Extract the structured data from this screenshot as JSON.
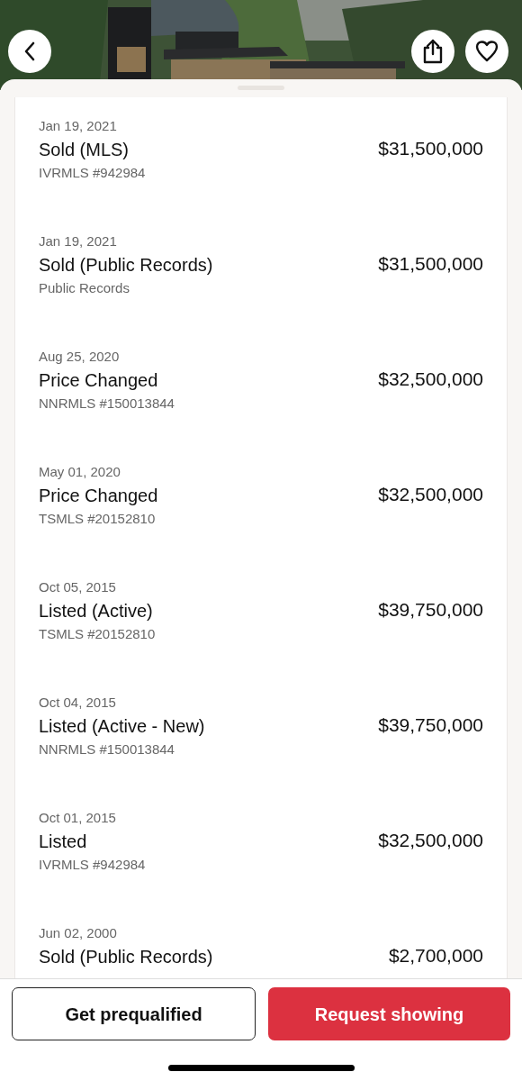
{
  "history": [
    {
      "date": "Jan 19, 2021",
      "event": "Sold (MLS)",
      "source": "IVRMLS #942984",
      "price": "$31,500,000"
    },
    {
      "date": "Jan 19, 2021",
      "event": "Sold (Public Records)",
      "source": "Public Records",
      "price": "$31,500,000"
    },
    {
      "date": "Aug 25, 2020",
      "event": "Price Changed",
      "source": "NNRMLS #150013844",
      "price": "$32,500,000"
    },
    {
      "date": "May 01, 2020",
      "event": "Price Changed",
      "source": "TSMLS #20152810",
      "price": "$32,500,000"
    },
    {
      "date": "Oct 05, 2015",
      "event": "Listed (Active)",
      "source": "TSMLS #20152810",
      "price": "$39,750,000"
    },
    {
      "date": "Oct 04, 2015",
      "event": "Listed (Active - New)",
      "source": "NNRMLS #150013844",
      "price": "$39,750,000"
    },
    {
      "date": "Oct 01, 2015",
      "event": "Listed",
      "source": "IVRMLS #942984",
      "price": "$32,500,000"
    },
    {
      "date": "Jun 02, 2000",
      "event": "Sold (Public Records)",
      "price": "$2,700,000"
    }
  ],
  "actions": {
    "secondary": "Get prequalified",
    "primary": "Request showing"
  }
}
